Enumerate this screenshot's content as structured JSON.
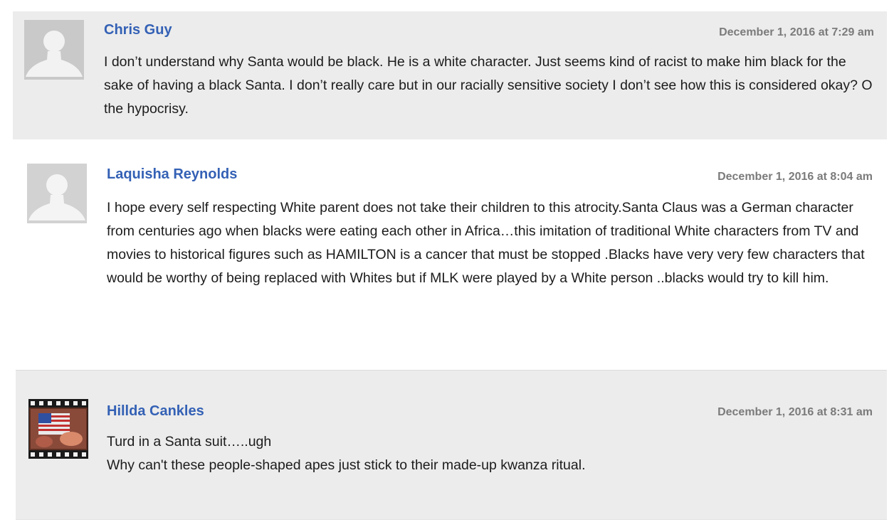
{
  "comments": [
    {
      "author": "Chris Guy",
      "date": "December 1, 2016 at 7:29 am",
      "avatar": "default-avatar-silhouette",
      "lines": [
        "I don’t understand why Santa would be black. He is a white character. Just seems kind of racist to make him black for the sake of having a black Santa. I don’t really care but in our racially sensitive society I don’t see how this is considered okay? O the hypocrisy."
      ]
    },
    {
      "author": "Laquisha Reynolds",
      "date": "December 1, 2016 at 8:04 am",
      "avatar": "default-avatar-silhouette",
      "lines": [
        "I hope every self respecting White parent does not take their children to this atrocity.Santa Claus was a German character from centuries ago when blacks were eating each other in Africa…this imitation of traditional White characters from TV and movies to historical figures such as HAMILTON is a cancer that must be stopped .Blacks have very very few characters that would be worthy of being replaced with Whites but if MLK were played by a White person ..blacks would try to kill him."
      ]
    },
    {
      "author": "Hillda Cankles",
      "date": "December 1, 2016 at 8:31 am",
      "avatar": "filmstrip-flag-avatar",
      "lines": [
        "Turd in a Santa suit…..ugh",
        "Why can't these people-shaped apes just stick to their made-up kwanza ritual."
      ]
    }
  ]
}
